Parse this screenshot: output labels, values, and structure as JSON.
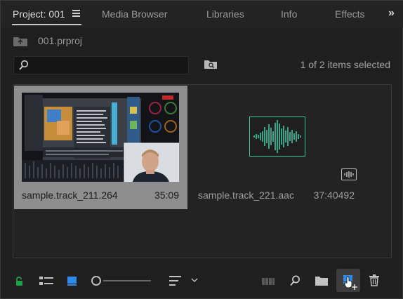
{
  "tabs": [
    {
      "label": "Project: 001",
      "active": true
    },
    {
      "label": "Media Browser",
      "active": false
    },
    {
      "label": "Libraries",
      "active": false
    },
    {
      "label": "Info",
      "active": false
    },
    {
      "label": "Effects",
      "active": false
    }
  ],
  "path": {
    "label": "001.prproj"
  },
  "search": {
    "value": "",
    "placeholder": ""
  },
  "selection_status": "1 of 2 items selected",
  "clips": [
    {
      "name": "sample.track_211.264",
      "duration": "35:09",
      "selected": true,
      "type": "video"
    },
    {
      "name": "sample.track_221.aac",
      "duration": "37:40492",
      "selected": false,
      "type": "audio"
    }
  ],
  "icons": {
    "panel_menu": "hamburger-icon",
    "overflow": "chevron-double-right-icon",
    "folder_up": "folder-up-icon",
    "search": "search-icon",
    "bin_search": "new-search-bin-icon",
    "audio_badge": "audio-waveform-badge-icon",
    "lock": "lock-icon",
    "list_view": "list-view-icon",
    "icon_view": "icon-view-icon",
    "zoom": "zoom-slider",
    "sort": "sort-icon",
    "sort_menu": "chevron-down-icon",
    "automate": "automate-to-sequence-icon",
    "find": "find-icon",
    "new_bin": "new-bin-icon",
    "new_item": "new-item-icon",
    "clear": "trash-icon"
  },
  "colors": {
    "accent_blue": "#2d8ceb",
    "lock_green": "#1fa04a",
    "waveform": "#43c59e",
    "selection": "#8e8e8e"
  }
}
